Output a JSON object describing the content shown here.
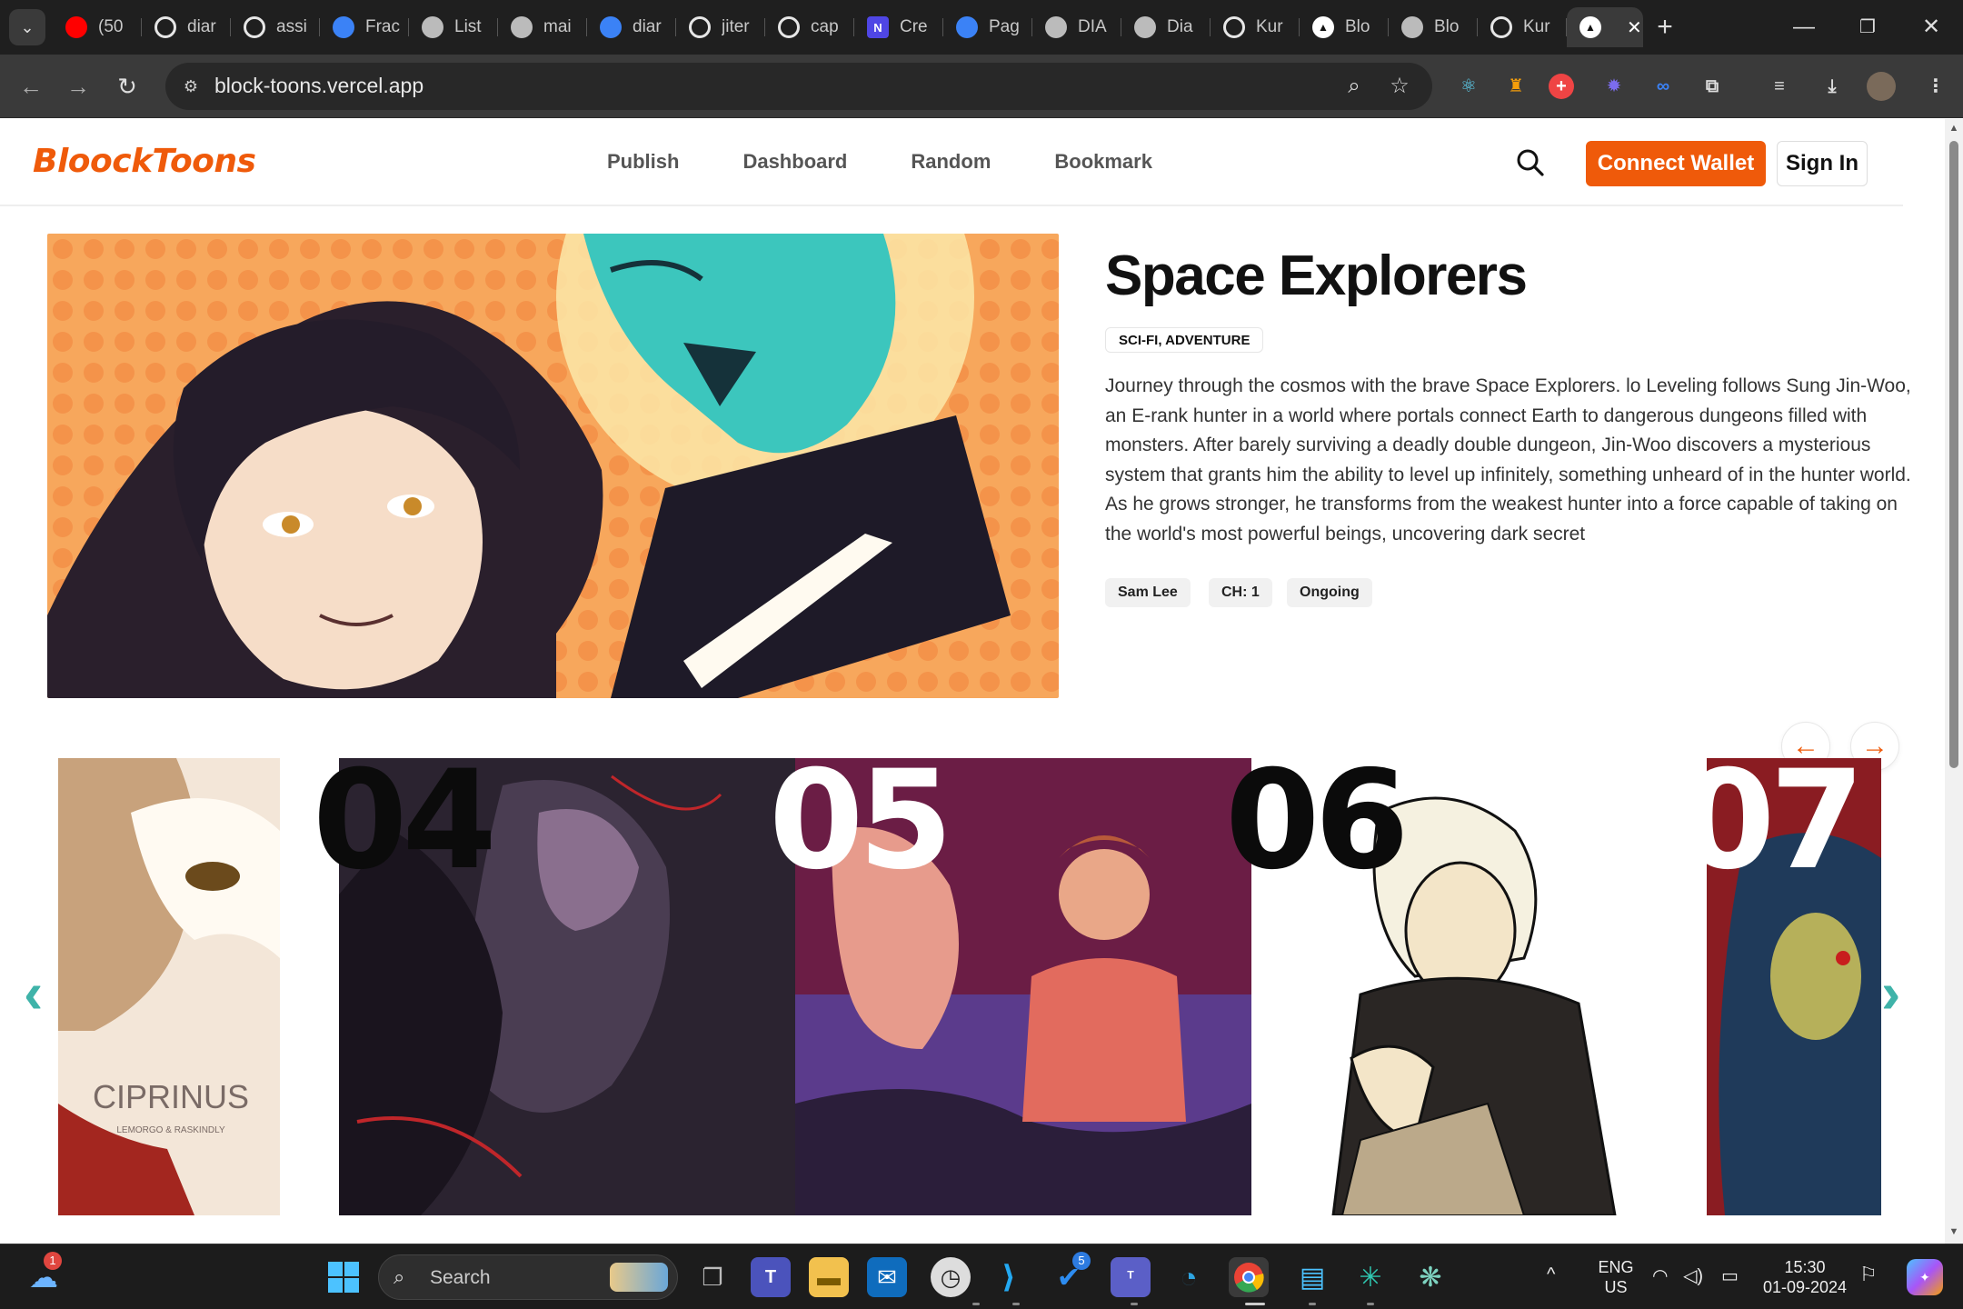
{
  "browser": {
    "tabs": [
      {
        "label": "(50",
        "icon": "youtube-icon",
        "color": "#ff0000"
      },
      {
        "label": "diar",
        "icon": "github-icon",
        "color": "#e6e6e6"
      },
      {
        "label": "assi",
        "icon": "github-icon",
        "color": "#e6e6e6"
      },
      {
        "label": "Frac",
        "icon": "doc-icon",
        "color": "#3b82f6"
      },
      {
        "label": "List",
        "icon": "globe-icon",
        "color": "#bbbbbb"
      },
      {
        "label": "mai",
        "icon": "globe-icon",
        "color": "#bbbbbb"
      },
      {
        "label": "diar",
        "icon": "drop-icon",
        "color": "#3b82f6"
      },
      {
        "label": "jiter",
        "icon": "github-icon",
        "color": "#e6e6e6"
      },
      {
        "label": "cap",
        "icon": "github-icon",
        "color": "#e6e6e6"
      },
      {
        "label": "Cre",
        "icon": "n-icon",
        "color": "#4f46e5"
      },
      {
        "label": "Pag",
        "icon": "wave-icon",
        "color": "#3b82f6"
      },
      {
        "label": "DIA",
        "icon": "globe-icon",
        "color": "#bbbbbb"
      },
      {
        "label": "Dia",
        "icon": "globe-icon",
        "color": "#bbbbbb"
      },
      {
        "label": "Kur",
        "icon": "github-icon",
        "color": "#e6e6e6"
      },
      {
        "label": "Blo",
        "icon": "triangle-icon",
        "color": "#111111"
      },
      {
        "label": "Blo",
        "icon": "globe-icon",
        "color": "#bbbbbb"
      },
      {
        "label": "Kur",
        "icon": "github-icon",
        "color": "#e6e6e6"
      }
    ],
    "url": "block-toons.vercel.app"
  },
  "site": {
    "logo": "BloockToons",
    "nav": [
      "Publish",
      "Dashboard",
      "Random",
      "Bookmark"
    ],
    "connect_label": "Connect Wallet",
    "signin_label": "Sign In",
    "accent": "#ef5a0a"
  },
  "hero": {
    "title": "Space Explorers",
    "genres": "SCI-FI, ADVENTURE",
    "description": "Journey through the cosmos with the brave Space Explorers. lo Leveling follows Sung Jin-Woo, an E-rank hunter in a world where portals connect Earth to dangerous dungeons filled with monsters. After barely surviving a deadly double dungeon, Jin-Woo discovers a mysterious system that grants him the ability to level up infinitely, something unheard of in the hunter world. As he grows stronger, he transforms from the weakest hunter into a force capable of taking on the world's most powerful beings, uncovering dark secret",
    "author": "Sam Lee",
    "chapter": "CH: 1",
    "status": "Ongoing"
  },
  "trending": {
    "cover_title": "CIPRINUS",
    "cover_credit": "LEMORGO & RASKINDLY",
    "ranks": [
      "04",
      "05",
      "06",
      "07"
    ]
  },
  "taskbar": {
    "search_label": "Search",
    "notification_count": "1",
    "badge_count": "5",
    "lang_line1": "ENG",
    "lang_line2": "US",
    "time": "15:30",
    "date": "01-09-2024"
  }
}
